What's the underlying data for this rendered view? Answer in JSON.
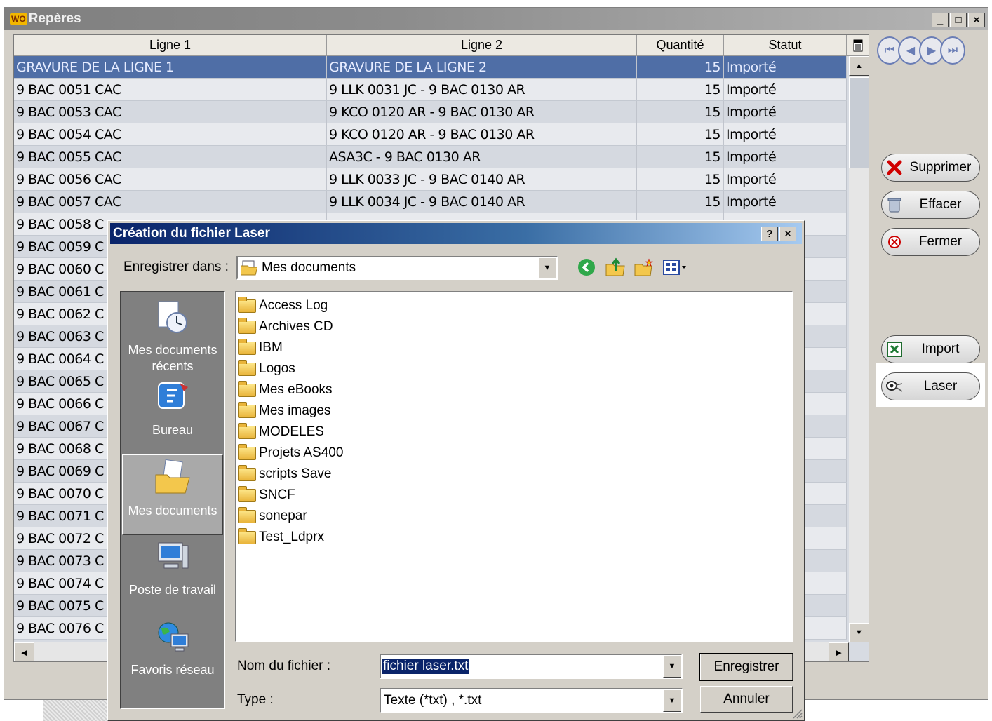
{
  "main_window": {
    "title": "Repères",
    "logo": "WO",
    "controls": {
      "minimize": "_",
      "maximize": "□",
      "close": "×"
    }
  },
  "grid": {
    "headers": [
      "Ligne 1",
      "Ligne 2",
      "Quantité",
      "Statut"
    ],
    "rows": [
      {
        "l1": "GRAVURE DE LA LIGNE 1",
        "l2": "GRAVURE DE LA LIGNE 2",
        "q": "15",
        "s": "Importé"
      },
      {
        "l1": "9 BAC 0051  CAC",
        "l2": "9 LLK 0031 JC  -  9 BAC 0130 AR",
        "q": "15",
        "s": "Importé"
      },
      {
        "l1": "9 BAC 0053  CAC",
        "l2": "9 KCO 0120 AR  -  9 BAC 0130 AR",
        "q": "15",
        "s": "Importé"
      },
      {
        "l1": "9 BAC 0054  CAC",
        "l2": "9 KCO 0120 AR  -  9 BAC 0130 AR",
        "q": "15",
        "s": "Importé"
      },
      {
        "l1": "9 BAC 0055  CAC",
        "l2": "ASA3C  -  9 BAC 0130 AR",
        "q": "15",
        "s": "Importé"
      },
      {
        "l1": "9 BAC 0056  CAC",
        "l2": "9 LLK 0033 JC  -  9 BAC 0140 AR",
        "q": "15",
        "s": "Importé"
      },
      {
        "l1": "9 BAC 0057  CAC",
        "l2": "9 LLK 0034 JC  -  9 BAC 0140 AR",
        "q": "15",
        "s": "Importé"
      },
      {
        "l1": "9 BAC 0058  C",
        "l2": "",
        "q": "",
        "s": ""
      },
      {
        "l1": "9 BAC 0059  C",
        "l2": "",
        "q": "",
        "s": ""
      },
      {
        "l1": "9 BAC 0060  C",
        "l2": "",
        "q": "",
        "s": ""
      },
      {
        "l1": "9 BAC 0061  C",
        "l2": "",
        "q": "",
        "s": ""
      },
      {
        "l1": "9 BAC 0062  C",
        "l2": "",
        "q": "",
        "s": ""
      },
      {
        "l1": "9 BAC 0063  C",
        "l2": "",
        "q": "",
        "s": ""
      },
      {
        "l1": "9 BAC 0064  C",
        "l2": "",
        "q": "",
        "s": ""
      },
      {
        "l1": "9 BAC 0065  C",
        "l2": "",
        "q": "",
        "s": ""
      },
      {
        "l1": "9 BAC 0066  C",
        "l2": "",
        "q": "",
        "s": ""
      },
      {
        "l1": "9 BAC 0067  C",
        "l2": "",
        "q": "",
        "s": ""
      },
      {
        "l1": "9 BAC 0068  C",
        "l2": "",
        "q": "",
        "s": ""
      },
      {
        "l1": "9 BAC 0069  C",
        "l2": "",
        "q": "",
        "s": ""
      },
      {
        "l1": "9 BAC 0070  C",
        "l2": "",
        "q": "",
        "s": ""
      },
      {
        "l1": "9 BAC 0071  C",
        "l2": "",
        "q": "",
        "s": ""
      },
      {
        "l1": "9 BAC 0072  C",
        "l2": "",
        "q": "",
        "s": ""
      },
      {
        "l1": "9 BAC 0073  C",
        "l2": "",
        "q": "",
        "s": ""
      },
      {
        "l1": "9 BAC 0074  C",
        "l2": "",
        "q": "",
        "s": ""
      },
      {
        "l1": "9 BAC 0075  C",
        "l2": "",
        "q": "",
        "s": ""
      },
      {
        "l1": "9 BAC 0076  C",
        "l2": "",
        "q": "",
        "s": ""
      }
    ]
  },
  "side": {
    "supprimer": "Supprimer",
    "effacer": "Effacer",
    "fermer": "Fermer",
    "import": "Import",
    "laser": "Laser"
  },
  "dialog": {
    "title": "Création du fichier Laser",
    "help": "?",
    "close": "×",
    "save_in_label": "Enregistrer dans :",
    "save_in_value": "Mes documents",
    "places": [
      "Mes documents récents",
      "Bureau",
      "Mes documents",
      "Poste de travail",
      "Favoris réseau"
    ],
    "folders": [
      "Access Log",
      "Archives CD",
      "IBM",
      "Logos",
      "Mes eBooks",
      "Mes images",
      "MODELES",
      "Projets AS400",
      "scripts Save",
      "SNCF",
      "sonepar",
      "Test_Ldprx"
    ],
    "filename_label": "Nom du fichier :",
    "filename_value": "fichier laser.txt",
    "type_label": "Type :",
    "type_value": "Texte (*txt) , *.txt",
    "save_button": "Enregistrer",
    "cancel_button": "Annuler"
  },
  "colors": {
    "selected_row": "#4f6ea6",
    "dialog_title": "#0a246a",
    "nav_accent": "#6a7db5"
  }
}
